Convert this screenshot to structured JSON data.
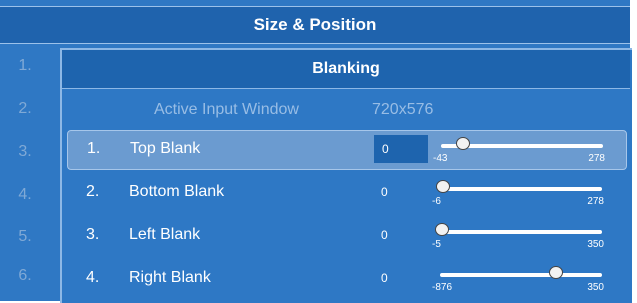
{
  "window": {
    "title": "Size & Position"
  },
  "outer_rows": [
    "1.",
    "2.",
    "3.",
    "4.",
    "5.",
    "6."
  ],
  "dialog": {
    "title": "Blanking",
    "info": {
      "label": "Active Input Window",
      "value": "720x576"
    },
    "rows": [
      {
        "num": "1.",
        "label": "Top Blank",
        "value": "0",
        "min": "-43",
        "max": "278",
        "level": 0.134,
        "selected": true
      },
      {
        "num": "2.",
        "label": "Bottom Blank",
        "value": "0",
        "min": "-6",
        "max": "278",
        "level": 0.021,
        "selected": false
      },
      {
        "num": "3.",
        "label": "Left Blank",
        "value": "0",
        "min": "-5",
        "max": "350",
        "level": 0.014,
        "selected": false
      },
      {
        "num": "4.",
        "label": "Right Blank",
        "value": "0",
        "min": "-876",
        "max": "350",
        "level": 0.714,
        "selected": false
      }
    ]
  },
  "colors": {
    "background": "#2f78c4",
    "title_bar": "#1f63ad",
    "selected_row": "#6b9bd0",
    "dim_text": "#98bde5"
  }
}
